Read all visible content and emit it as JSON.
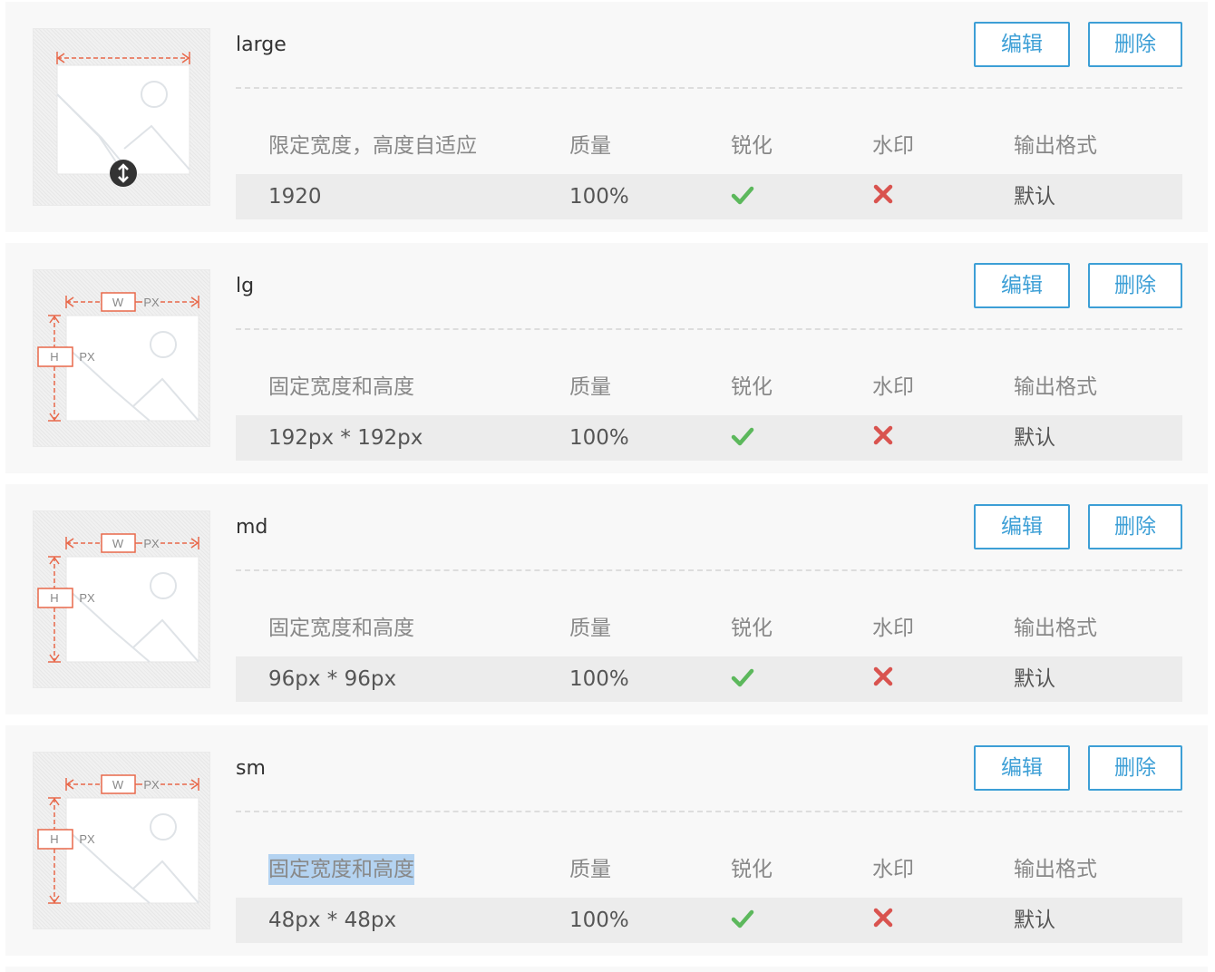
{
  "columns": {
    "quality": "质量",
    "sharpen": "锐化",
    "watermark": "水印",
    "format": "输出格式"
  },
  "buttons": {
    "edit": "编辑",
    "delete": "删除"
  },
  "diagram_labels": {
    "w": "W",
    "h": "H",
    "px": "PX"
  },
  "colors": {
    "accent": "#3d9fd6",
    "check": "#5cb85c",
    "cross": "#d9534f",
    "dimension": "#e8684a"
  },
  "presets": [
    {
      "name": "large",
      "mode_label": "限定宽度，高度自适应",
      "size": "1920",
      "quality": "100%",
      "sharpen": "check-icon",
      "watermark": "cross-icon",
      "format": "默认",
      "thumb_icon": "fixed-width-auto-height-icon"
    },
    {
      "name": "lg",
      "mode_label": "固定宽度和高度",
      "size": "192px * 192px",
      "quality": "100%",
      "sharpen": "check-icon",
      "watermark": "cross-icon",
      "format": "默认",
      "thumb_icon": "fixed-width-height-icon"
    },
    {
      "name": "md",
      "mode_label": "固定宽度和高度",
      "size": "96px * 96px",
      "quality": "100%",
      "sharpen": "check-icon",
      "watermark": "cross-icon",
      "format": "默认",
      "thumb_icon": "fixed-width-height-icon"
    },
    {
      "name": "sm",
      "mode_label": "固定宽度和高度",
      "size": "48px * 48px",
      "quality": "100%",
      "sharpen": "check-icon",
      "watermark": "cross-icon",
      "format": "默认",
      "thumb_icon": "fixed-width-height-icon",
      "mode_label_selected": true
    }
  ]
}
